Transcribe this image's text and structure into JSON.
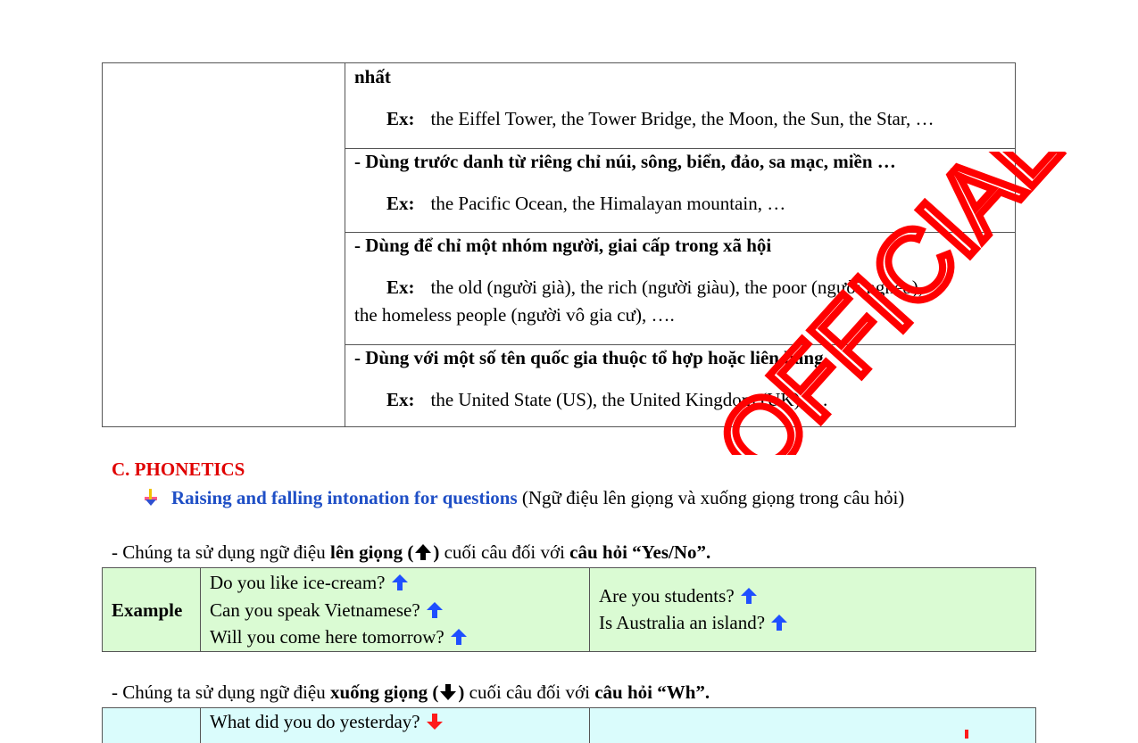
{
  "top_table": {
    "rows": [
      {
        "heading": "nhất",
        "example": "the Eiffel Tower, the Tower Bridge, the Moon, the Sun, the Star, …"
      },
      {
        "heading": "- Dùng trước danh từ riêng chỉ núi, sông, biển, đảo, sa mạc, miền …",
        "example": "the Pacific Ocean, the Himalayan mountain, …"
      },
      {
        "heading": "- Dùng để chỉ một nhóm người, giai cấp trong xã hội",
        "example": "the old (người già), the rich (người giàu), the poor (người nghèo),",
        "example_cont": "the homeless people (người vô gia cư), …."
      },
      {
        "heading": "- Dùng với một số tên quốc gia thuộc tổ hợp hoặc liên bang.",
        "example": "the United State (US), the United Kingdom (UK), …"
      }
    ],
    "ex_label": "Ex:"
  },
  "phonetics": {
    "title": "C. PHONETICS",
    "bullet_bold": "Raising and falling intonation for questions",
    "bullet_rest": " (Ngữ điệu lên giọng và xuống giọng trong câu hỏi)"
  },
  "rule_rising": {
    "prefix": "- Chúng ta sử dụng ngữ điệu ",
    "bold1": "lên giọng (",
    "bold1_end": ")",
    "middle": " cuối câu đối với ",
    "bold2": "câu hỏi “Yes/No”."
  },
  "rising_table": {
    "label": "Example",
    "left": [
      "Do you like ice-cream?",
      "Can you speak Vietnamese?",
      "Will you come here tomorrow?"
    ],
    "right": [
      "Are you students?",
      "Is Australia an island?"
    ],
    "bg_color": "#dafbd3"
  },
  "rule_falling": {
    "prefix": "- Chúng ta sử dụng ngữ điệu ",
    "bold1": "xuống giọng (",
    "bold1_end": ")",
    "middle": " cuối câu đối với ",
    "bold2": "câu hỏi “Wh”."
  },
  "falling_table": {
    "left": [
      "What did you do yesterday?"
    ],
    "bg_color": "#dafcfc"
  },
  "watermark": {
    "text": "OFFICIAL",
    "color": "#ff0000"
  },
  "colors": {
    "arrow_up": "#1f4fff",
    "arrow_down": "#ff1a1a",
    "section_title": "#e00000",
    "bullet_title": "#1f4fc6"
  }
}
